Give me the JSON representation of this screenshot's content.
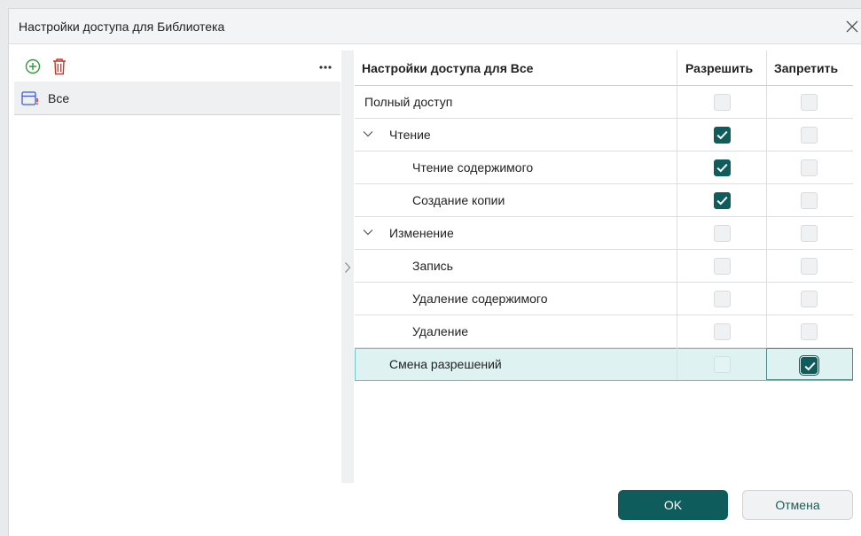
{
  "dialog": {
    "title": "Настройки доступа для Библиотека"
  },
  "left": {
    "groups": [
      {
        "label": "Все"
      }
    ]
  },
  "table": {
    "headers": {
      "name": "Настройки доступа для Все",
      "allow": "Разрешить",
      "deny": "Запретить"
    },
    "rows": [
      {
        "label": "Полный доступ",
        "level": 0,
        "allow": false,
        "deny": false
      },
      {
        "label": "Чтение",
        "level": 1,
        "expanded": true,
        "allow": true,
        "deny": false
      },
      {
        "label": "Чтение содержимого",
        "level": 2,
        "allow": true,
        "deny": false
      },
      {
        "label": "Создание копии",
        "level": 2,
        "allow": true,
        "deny": false
      },
      {
        "label": "Изменение",
        "level": 1,
        "expanded": true,
        "allow": false,
        "deny": false
      },
      {
        "label": "Запись",
        "level": 2,
        "allow": false,
        "deny": false
      },
      {
        "label": "Удаление содержимого",
        "level": 2,
        "allow": false,
        "deny": false
      },
      {
        "label": "Удаление",
        "level": 2,
        "allow": false,
        "deny": false
      },
      {
        "label": "Смена разрешений",
        "level": 1,
        "allow": false,
        "deny": true,
        "selected": true
      }
    ]
  },
  "buttons": {
    "ok": "OK",
    "cancel": "Отмена"
  },
  "colors": {
    "accent": "#0f5c5c",
    "selection": "#dff2f2",
    "delete": "#c0392b",
    "add": "#2e9a3a"
  },
  "icons": {
    "add": "plus-circle-icon",
    "delete": "trash-icon",
    "more": "ellipsis-icon",
    "group": "group-icon",
    "close": "close-icon",
    "expander": "chevron-down-icon",
    "splitter": "chevron-right-icon"
  }
}
